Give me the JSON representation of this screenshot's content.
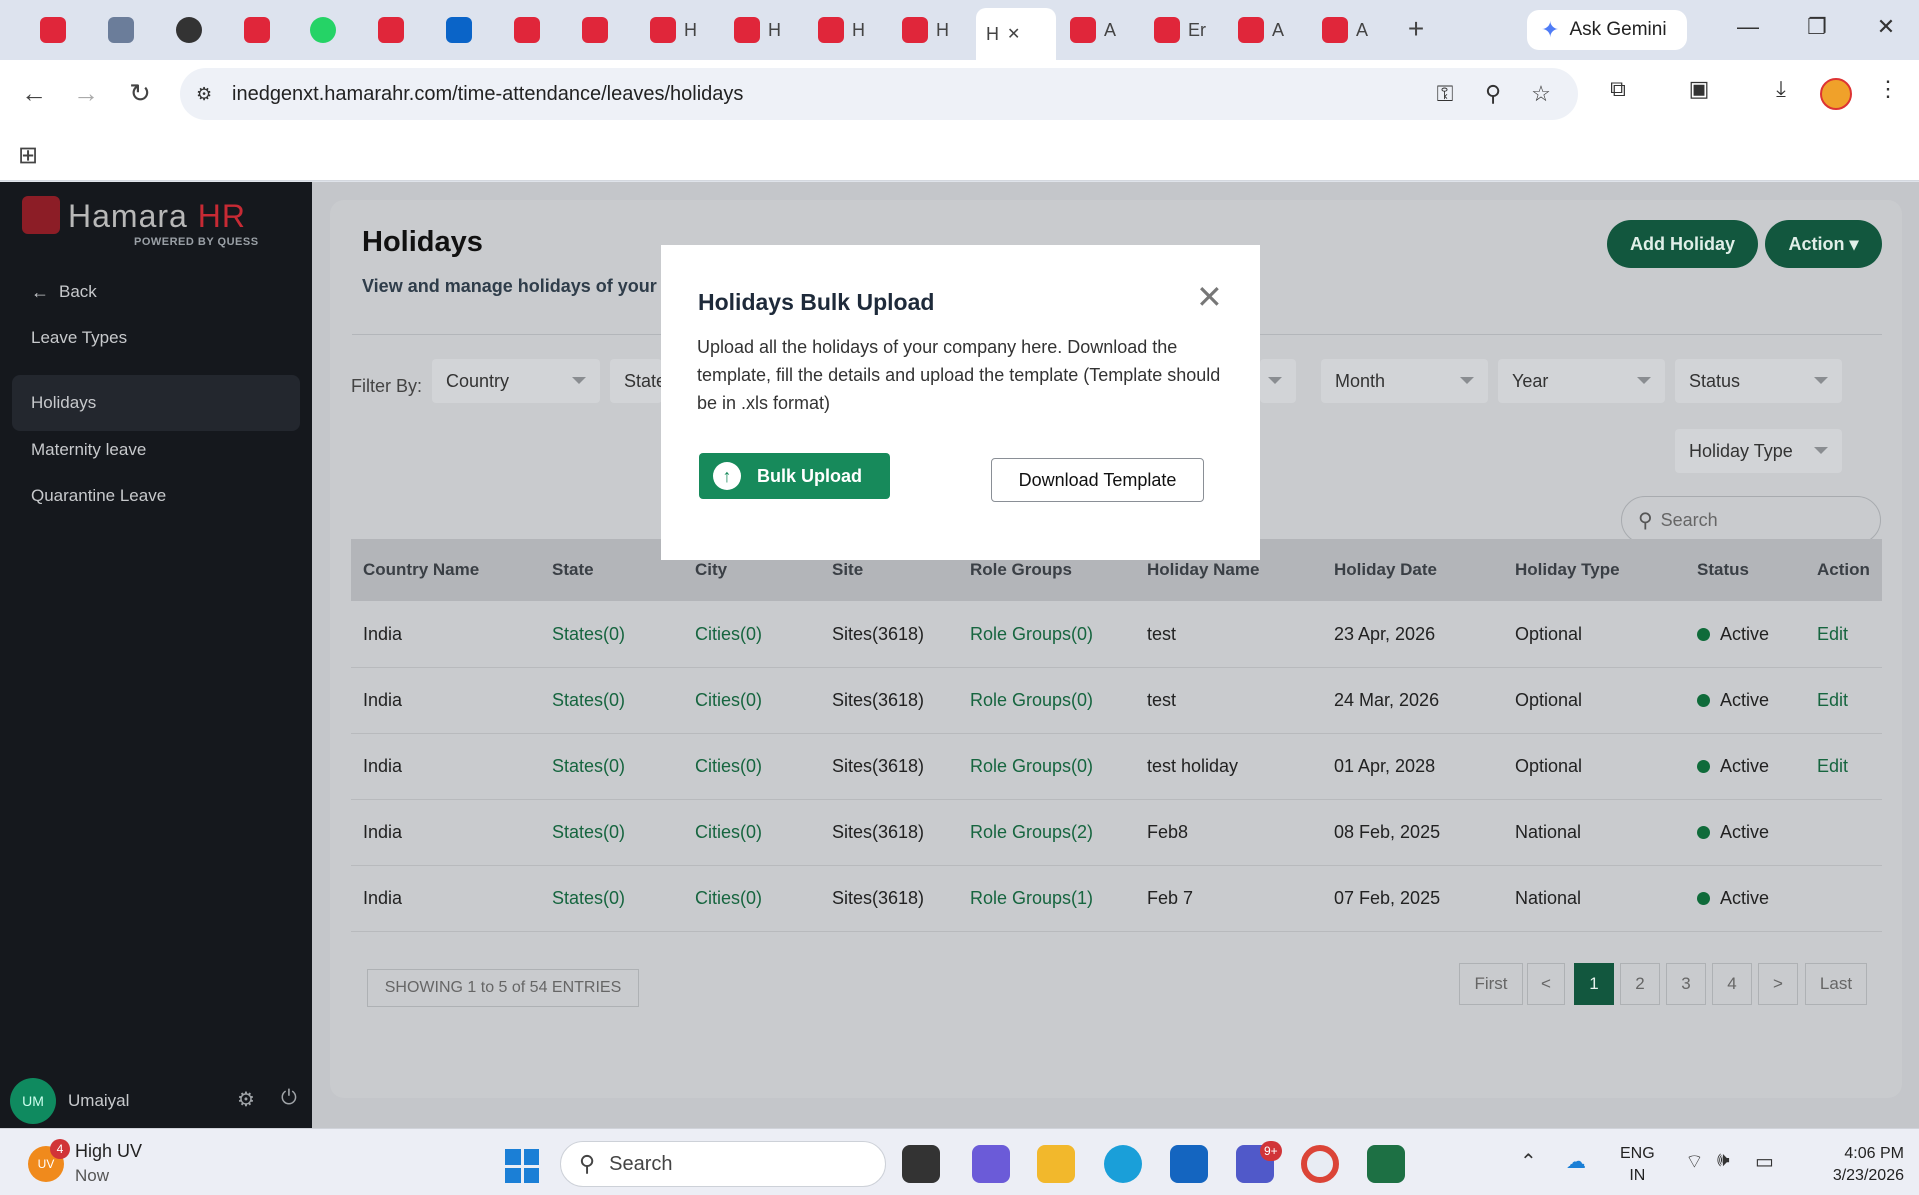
{
  "browser": {
    "tabs": [
      {
        "letter": "",
        "icon": "app-icon"
      },
      {
        "letter": "",
        "icon": "search-app-icon"
      },
      {
        "letter": "",
        "icon": "chatgpt-icon"
      },
      {
        "letter": "",
        "icon": "app-icon"
      },
      {
        "letter": "",
        "icon": "whatsapp-icon"
      },
      {
        "letter": "",
        "icon": "hamarahr-icon"
      },
      {
        "letter": "",
        "icon": "outlook-icon"
      },
      {
        "letter": "",
        "icon": "hamarahr-icon"
      },
      {
        "letter": "",
        "icon": "hamarahr-icon"
      },
      {
        "letter": "H",
        "icon": "hamarahr-icon"
      },
      {
        "letter": "H",
        "icon": "hamarahr-icon"
      },
      {
        "letter": "H",
        "icon": "hamarahr-icon"
      },
      {
        "letter": "H",
        "icon": "hamarahr-icon"
      },
      {
        "letter": "H",
        "icon": "",
        "active": true
      },
      {
        "letter": "A",
        "icon": "hamarahr-icon"
      },
      {
        "letter": "Er",
        "icon": "hamarahr-icon"
      },
      {
        "letter": "A",
        "icon": "hamarahr-icon"
      },
      {
        "letter": "A",
        "icon": "hamarahr-icon"
      }
    ],
    "gemini_label": "Ask Gemini",
    "url": "inedgenxt.hamarahr.com/time-attendance/leaves/holidays"
  },
  "sidebar": {
    "logo_name": "Hamara",
    "logo_hr": "HR",
    "logo_tag": "POWERED BY QUESS",
    "back_label": "Back",
    "items": [
      {
        "label": "Leave Types"
      },
      {
        "label": "Holidays",
        "active": true
      },
      {
        "label": "Maternity leave"
      },
      {
        "label": "Quarantine Leave"
      }
    ],
    "user_initials": "UM",
    "user_name": "Umaiyal"
  },
  "page": {
    "title": "Holidays",
    "subtitle": "View and manage holidays of your",
    "add_button": "Add Holiday",
    "action_button": "Action ▾",
    "filter_label": "Filter By:",
    "filters": {
      "country": "Country",
      "state": "State",
      "month": "Month",
      "year": "Year",
      "status": "Status",
      "holiday_type": "Holiday Type"
    },
    "search_placeholder": "Search"
  },
  "table": {
    "headers": [
      "Country Name",
      "State",
      "City",
      "Site",
      "Role Groups",
      "Holiday Name",
      "Holiday Date",
      "Holiday Type",
      "Status",
      "Action"
    ],
    "rows": [
      {
        "country": "India",
        "state": "States(0)",
        "city": "Cities(0)",
        "site": "Sites(3618)",
        "role_groups": "Role Groups(0)",
        "name": "test",
        "date": "23 Apr, 2026",
        "type": "Optional",
        "status": "Active",
        "action": "Edit"
      },
      {
        "country": "India",
        "state": "States(0)",
        "city": "Cities(0)",
        "site": "Sites(3618)",
        "role_groups": "Role Groups(0)",
        "name": "test",
        "date": "24 Mar, 2026",
        "type": "Optional",
        "status": "Active",
        "action": "Edit"
      },
      {
        "country": "India",
        "state": "States(0)",
        "city": "Cities(0)",
        "site": "Sites(3618)",
        "role_groups": "Role Groups(0)",
        "name": "test holiday",
        "date": "01 Apr, 2028",
        "type": "Optional",
        "status": "Active",
        "action": "Edit"
      },
      {
        "country": "India",
        "state": "States(0)",
        "city": "Cities(0)",
        "site": "Sites(3618)",
        "role_groups": "Role Groups(2)",
        "name": "Feb8",
        "date": "08 Feb, 2025",
        "type": "National",
        "status": "Active",
        "action": ""
      },
      {
        "country": "India",
        "state": "States(0)",
        "city": "Cities(0)",
        "site": "Sites(3618)",
        "role_groups": "Role Groups(1)",
        "name": "Feb 7",
        "date": "07 Feb, 2025",
        "type": "National",
        "status": "Active",
        "action": ""
      }
    ],
    "showing": "SHOWING 1 to 5 of 54 ENTRIES",
    "pagination": [
      "First",
      "<",
      "1",
      "2",
      "3",
      "4",
      ">",
      "Last"
    ],
    "current_page": "1"
  },
  "modal": {
    "title": "Holidays Bulk Upload",
    "description": "Upload all the holidays of your company here. Download the template, fill the details and upload the template (Template should be in .xls format)",
    "upload_button": "Bulk Upload",
    "download_button": "Download Template",
    "close_glyph": "✕"
  },
  "taskbar": {
    "weather_badge": "4",
    "weather_icon_text": "UV",
    "weather_title": "High UV",
    "weather_sub": "Now",
    "search_placeholder": "Search",
    "teams_badge": "9+",
    "lang_1": "ENG",
    "lang_2": "IN",
    "time": "4:06 PM",
    "date": "3/23/2026"
  },
  "colors": {
    "brand_green": "#12573e",
    "link_green": "#16653f",
    "upload_green": "#178a5b",
    "hamara_red": "#c72a34"
  }
}
